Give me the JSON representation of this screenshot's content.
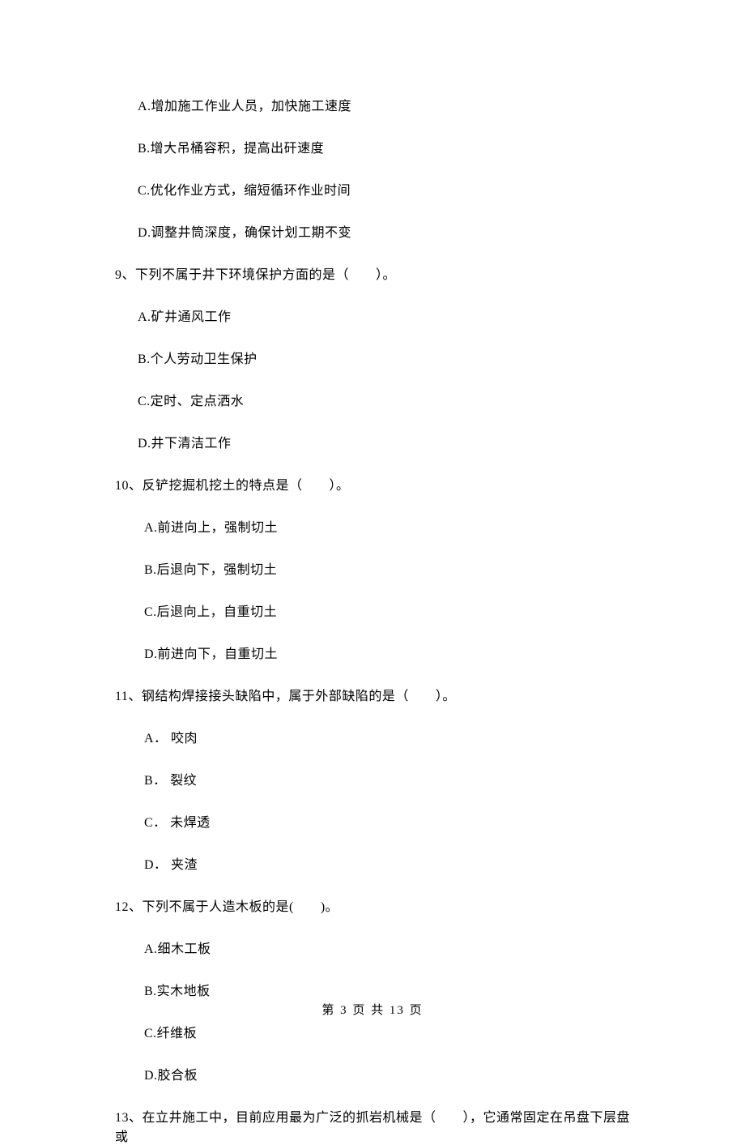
{
  "options_q8": {
    "a": "A.增加施工作业人员，加快施工速度",
    "b": "B.增大吊桶容积，提高出矸速度",
    "c": "C.优化作业方式，缩短循环作业时间",
    "d": "D.调整井筒深度，确保计划工期不变"
  },
  "question_9": "9、下列不属于井下环境保护方面的是（　　）。",
  "options_q9": {
    "a": "A.矿井通风工作",
    "b": "B.个人劳动卫生保护",
    "c": "C.定时、定点洒水",
    "d": "D.井下清洁工作"
  },
  "question_10": "10、反铲挖掘机挖土的特点是（　　）。",
  "options_q10": {
    "a": "A.前进向上，强制切土",
    "b": "B.后退向下，强制切土",
    "c": "C.后退向上，自重切土",
    "d": "D.前进向下，自重切土"
  },
  "question_11": "11、钢结构焊接接头缺陷中，属于外部缺陷的是（　　）。",
  "options_q11": {
    "a": "A． 咬肉",
    "b": "B． 裂纹",
    "c": "C． 未焊透",
    "d": "D． 夹渣"
  },
  "question_12": "12、下列不属于人造木板的是(　　)。",
  "options_q12": {
    "a": "A.细木工板",
    "b": "B.实木地板",
    "c": "C.纤维板",
    "d": "D.胶合板"
  },
  "question_13": "13、在立井施工中，目前应用最为广泛的抓岩机械是（　　），它通常固定在吊盘下层盘或",
  "footer": "第 3 页 共 13 页"
}
